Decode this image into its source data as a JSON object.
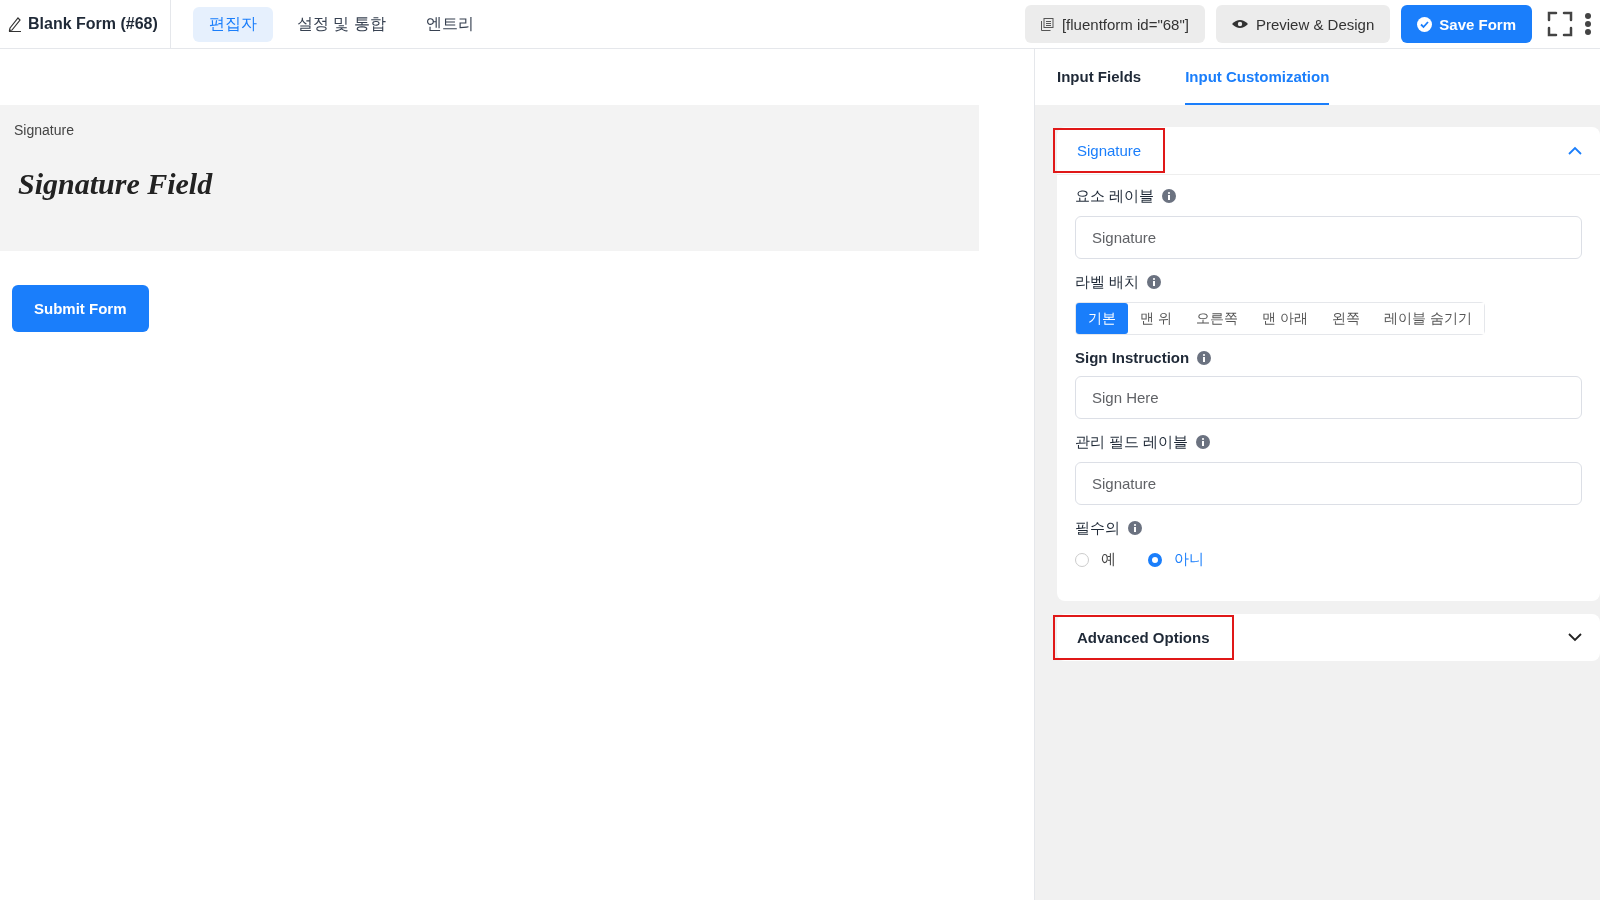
{
  "header": {
    "form_title": "Blank Form (#68)",
    "tabs": [
      {
        "label": "편집자",
        "selected": true
      },
      {
        "label": "설정 및 통합",
        "selected": false
      },
      {
        "label": "엔트리",
        "selected": false
      }
    ],
    "shortcode": "[fluentform id=\"68\"]",
    "preview_button": "Preview & Design",
    "save_button": "Save Form"
  },
  "canvas": {
    "field_label": "Signature",
    "signature_text": "Signature Field",
    "submit_button": "Submit Form"
  },
  "panel": {
    "tabs": [
      {
        "label": "Input Fields",
        "selected": false
      },
      {
        "label": "Input Customization",
        "selected": true
      }
    ],
    "sections": [
      {
        "title": "Signature",
        "expanded": true,
        "highlighted": true,
        "fields": [
          {
            "kind": "text",
            "label": "요소 레이블",
            "value": "Signature"
          },
          {
            "kind": "segmented",
            "label": "라벨 배치",
            "options": [
              {
                "label": "기본",
                "selected": true
              },
              {
                "label": "맨 위",
                "selected": false
              },
              {
                "label": "오른쪽",
                "selected": false
              },
              {
                "label": "맨 아래",
                "selected": false
              },
              {
                "label": "왼쪽",
                "selected": false
              },
              {
                "label": "레이블 숨기기",
                "selected": false
              }
            ]
          },
          {
            "kind": "text",
            "label": "Sign Instruction",
            "value": "Sign Here"
          },
          {
            "kind": "text",
            "label": "관리 필드 레이블",
            "value": "Signature"
          },
          {
            "kind": "radio",
            "label": "필수의",
            "options": [
              {
                "label": "예",
                "selected": false
              },
              {
                "label": "아니",
                "selected": true
              }
            ]
          }
        ]
      },
      {
        "title": "Advanced Options",
        "expanded": false,
        "highlighted": true
      }
    ]
  }
}
